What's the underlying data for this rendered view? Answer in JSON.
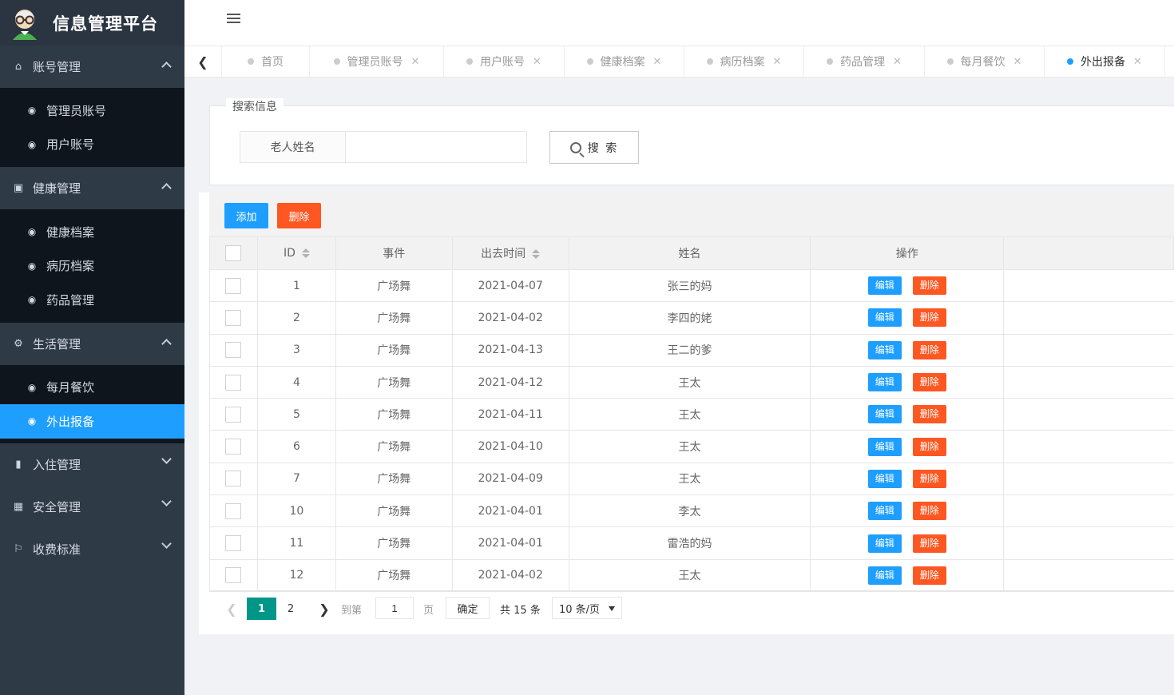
{
  "app": {
    "title": "信息管理平台"
  },
  "sidebar": {
    "groups": [
      {
        "label": "账号管理",
        "icon": "home-icon",
        "expanded": true,
        "items": [
          {
            "label": "管理员账号"
          },
          {
            "label": "用户账号"
          }
        ]
      },
      {
        "label": "健康管理",
        "icon": "window-icon",
        "expanded": true,
        "items": [
          {
            "label": "健康档案"
          },
          {
            "label": "病历档案"
          },
          {
            "label": "药品管理"
          }
        ]
      },
      {
        "label": "生活管理",
        "icon": "gears-icon",
        "expanded": true,
        "items": [
          {
            "label": "每月餐饮"
          },
          {
            "label": "外出报备",
            "active": true
          }
        ]
      },
      {
        "label": "入住管理",
        "icon": "file-icon",
        "expanded": false,
        "items": []
      },
      {
        "label": "安全管理",
        "icon": "gift-icon",
        "expanded": false,
        "items": []
      },
      {
        "label": "收费标准",
        "icon": "flag-icon",
        "expanded": false,
        "items": []
      }
    ]
  },
  "tabs": [
    {
      "label": "首页",
      "closable": false
    },
    {
      "label": "管理员账号",
      "closable": true
    },
    {
      "label": "用户账号",
      "closable": true
    },
    {
      "label": "健康档案",
      "closable": true
    },
    {
      "label": "病历档案",
      "closable": true
    },
    {
      "label": "药品管理",
      "closable": true
    },
    {
      "label": "每月餐饮",
      "closable": true
    },
    {
      "label": "外出报备",
      "closable": true,
      "active": true
    }
  ],
  "search": {
    "legend": "搜索信息",
    "field_label": "老人姓名",
    "value": "",
    "button_label": "搜 索"
  },
  "toolbar": {
    "add_label": "添加",
    "delete_label": "删除"
  },
  "table": {
    "columns": [
      "ID",
      "事件",
      "出去时间",
      "姓名",
      "操作"
    ],
    "edit_label": "编辑",
    "delete_label": "删除",
    "rows": [
      {
        "id": "1",
        "event": "广场舞",
        "time": "2021-04-07",
        "name": "张三的妈"
      },
      {
        "id": "2",
        "event": "广场舞",
        "time": "2021-04-02",
        "name": "李四的姥"
      },
      {
        "id": "3",
        "event": "广场舞",
        "time": "2021-04-13",
        "name": "王二的爹"
      },
      {
        "id": "4",
        "event": "广场舞",
        "time": "2021-04-12",
        "name": "王太"
      },
      {
        "id": "5",
        "event": "广场舞",
        "time": "2021-04-11",
        "name": "王太"
      },
      {
        "id": "6",
        "event": "广场舞",
        "time": "2021-04-10",
        "name": "王太"
      },
      {
        "id": "7",
        "event": "广场舞",
        "time": "2021-04-09",
        "name": "王太"
      },
      {
        "id": "10",
        "event": "广场舞",
        "time": "2021-04-01",
        "name": "李太"
      },
      {
        "id": "11",
        "event": "广场舞",
        "time": "2021-04-01",
        "name": "雷浩的妈"
      },
      {
        "id": "12",
        "event": "广场舞",
        "time": "2021-04-02",
        "name": "王太"
      }
    ]
  },
  "pager": {
    "current": "1",
    "page2": "2",
    "goto_label": "到第",
    "goto_value": "1",
    "page_unit": "页",
    "confirm_label": "确定",
    "total": "共 15 条",
    "page_size": "10 条/页"
  },
  "colors": {
    "primary": "#1e9fff",
    "danger": "#ff5722",
    "pager_active": "#009688",
    "sidebar": "#2f3a47"
  }
}
